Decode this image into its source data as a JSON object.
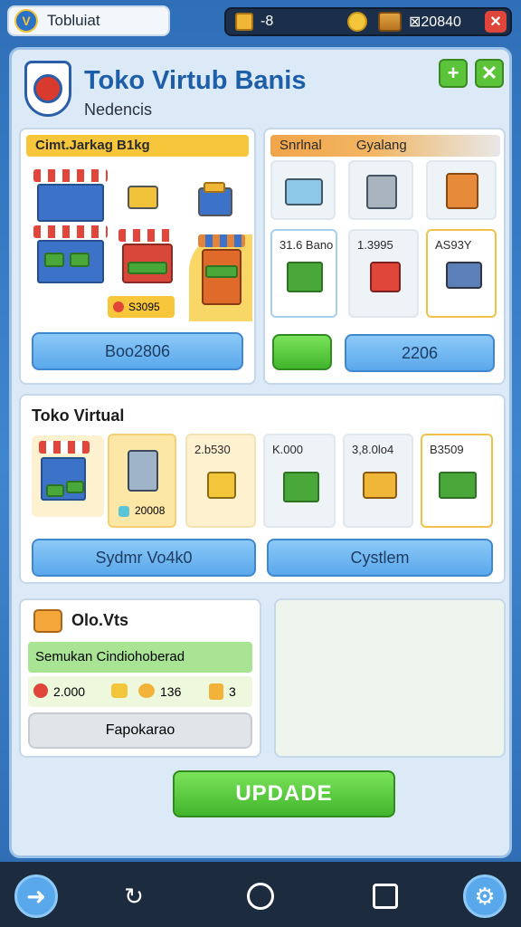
{
  "topbar": {
    "app_label": "Tobluiat",
    "resource1": "-8",
    "resource2": "",
    "resource3": "⊠20840",
    "close_icon": "close-icon"
  },
  "header": {
    "title": "Toko Virtub Banis",
    "subtitle": "Nedencis"
  },
  "panel_market": {
    "title": "Cimt.Jarkag B1kg",
    "badge": "S3095",
    "button": "Boo2806"
  },
  "panel_equipment": {
    "title_left": "Snrlnal",
    "title_right": "Gyalang",
    "tiles": [
      {
        "label": ""
      },
      {
        "label": ""
      },
      {
        "label": ""
      },
      {
        "label": "31.6 Bano"
      },
      {
        "label": "1.3995"
      },
      {
        "label": "AS93Y"
      }
    ],
    "button": "2206"
  },
  "panel_virtual": {
    "title": "Toko Virtual",
    "tiles": [
      {
        "label": "20008"
      },
      {
        "label": "2.b530"
      },
      {
        "label": "K.000"
      },
      {
        "label": "3,8.0lo4"
      },
      {
        "label": "B3509"
      }
    ],
    "button_left": "Sydmr Vo4k0",
    "button_right": "Cystlem"
  },
  "panel_stats": {
    "title": "Olo.Vts",
    "banner": "Semukan  Cindiohoberad",
    "stat1": "2.000",
    "stat2": "136",
    "stat3": "3",
    "button": "Fapokarao"
  },
  "update_button": "UPDADE",
  "colors": {
    "accent_blue": "#1d5ea8",
    "green": "#41b52d",
    "yellow": "#f8c63b"
  }
}
